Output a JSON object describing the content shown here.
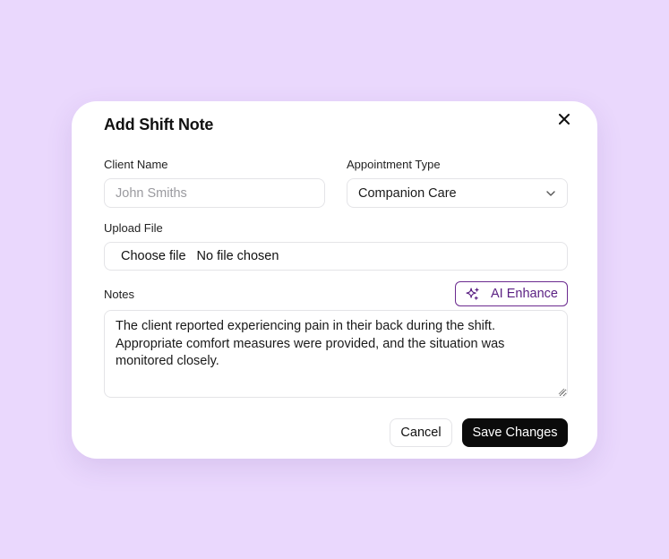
{
  "modal": {
    "title": "Add Shift Note",
    "close_icon": "close-icon"
  },
  "client_name": {
    "label": "Client Name",
    "value": "",
    "placeholder": "John Smiths"
  },
  "appointment_type": {
    "label": "Appointment Type",
    "selected": "Companion Care",
    "icon": "chevron-down-icon"
  },
  "upload_file": {
    "label": "Upload File",
    "button_label": "Choose file",
    "status": "No file chosen"
  },
  "notes": {
    "label": "Notes",
    "value": "The client reported experiencing pain in their back during the shift. Appropriate comfort measures were provided, and the situation was monitored closely.",
    "ai_button_label": "AI Enhance",
    "ai_icon": "sparkles-icon"
  },
  "actions": {
    "cancel_label": "Cancel",
    "save_label": "Save Changes"
  },
  "colors": {
    "background": "#ead8fd",
    "accent": "#5b2183",
    "primary_button": "#0b0b0b"
  }
}
